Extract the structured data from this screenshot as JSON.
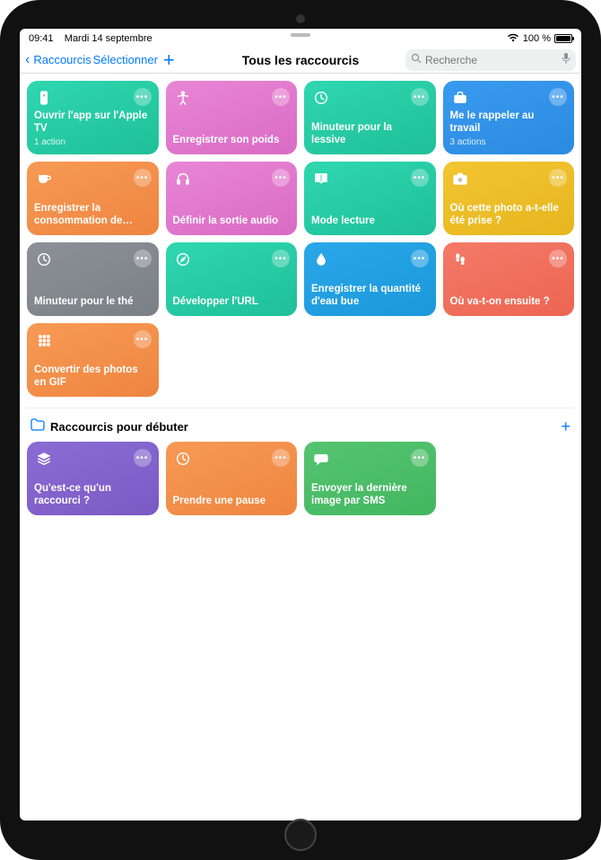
{
  "status": {
    "time": "09:41",
    "date": "Mardi 14 septembre",
    "battery_text": "100 %",
    "wifi_icon": "wifi-icon",
    "battery_icon": "battery-icon"
  },
  "nav": {
    "back_label": "Raccourcis",
    "select_label": "Sélectionner",
    "add_label": "+",
    "title": "Tous les raccourcis",
    "search_placeholder": "Recherche",
    "mic_icon": "mic-icon",
    "search_icon": "search-icon",
    "chevron_icon": "chevron-left-icon"
  },
  "shortcuts": [
    {
      "title": "Ouvrir l'app sur l'Apple TV",
      "sub": "1 action",
      "icon": "appletv-remote-icon",
      "color1": "#2fd7b0",
      "color2": "#1fbf99"
    },
    {
      "title": "Enregistrer son poids",
      "sub": "",
      "icon": "accessibility-icon",
      "color1": "#e986d6",
      "color2": "#d96bc4"
    },
    {
      "title": "Minuteur pour la lessive",
      "sub": "",
      "icon": "clock-icon",
      "color1": "#2fd7b0",
      "color2": "#1fbf99"
    },
    {
      "title": "Me le rappeler au travail",
      "sub": "3 actions",
      "icon": "briefcase-icon",
      "color1": "#3a9af0",
      "color2": "#2a8be0"
    },
    {
      "title": "Enregistrer la consommation de…",
      "sub": "",
      "icon": "cup-icon",
      "color1": "#f79a55",
      "color2": "#ee8540"
    },
    {
      "title": "Définir la sortie audio",
      "sub": "",
      "icon": "headphones-icon",
      "color1": "#e986d6",
      "color2": "#d96bc4"
    },
    {
      "title": "Mode lecture",
      "sub": "",
      "icon": "book-icon",
      "color1": "#2fd7b0",
      "color2": "#1fbf99"
    },
    {
      "title": "Où cette photo a-t-elle été prise ?",
      "sub": "",
      "icon": "camera-icon",
      "color1": "#f2c531",
      "color2": "#e6b61f"
    },
    {
      "title": "Minuteur pour le thé",
      "sub": "",
      "icon": "clock-icon",
      "color1": "#8c9197",
      "color2": "#7b8086"
    },
    {
      "title": "Développer l'URL",
      "sub": "",
      "icon": "compass-icon",
      "color1": "#2fd7b0",
      "color2": "#1fbf99"
    },
    {
      "title": "Enregistrer la quantité d'eau bue",
      "sub": "",
      "icon": "drop-icon",
      "color1": "#2aa7e8",
      "color2": "#1a98db"
    },
    {
      "title": "Où va-t-on ensuite ?",
      "sub": "",
      "icon": "footsteps-icon",
      "color1": "#f47a68",
      "color2": "#ec6552"
    },
    {
      "title": "Convertir des photos en GIF",
      "sub": "",
      "icon": "grid-icon",
      "color1": "#f79a55",
      "color2": "#ee8540"
    }
  ],
  "section": {
    "title": "Raccourcis pour débuter",
    "folder_icon": "folder-icon",
    "add_label": "+"
  },
  "starter_shortcuts": [
    {
      "title": "Qu'est-ce qu'un raccourci ?",
      "sub": "",
      "icon": "layers-icon",
      "color1": "#8b6bd4",
      "color2": "#7a5ac4"
    },
    {
      "title": "Prendre une pause",
      "sub": "",
      "icon": "clock-icon",
      "color1": "#f79a55",
      "color2": "#ee8540"
    },
    {
      "title": "Envoyer la dernière image par SMS",
      "sub": "",
      "icon": "speech-icon",
      "color1": "#54c470",
      "color2": "#44b660"
    }
  ]
}
